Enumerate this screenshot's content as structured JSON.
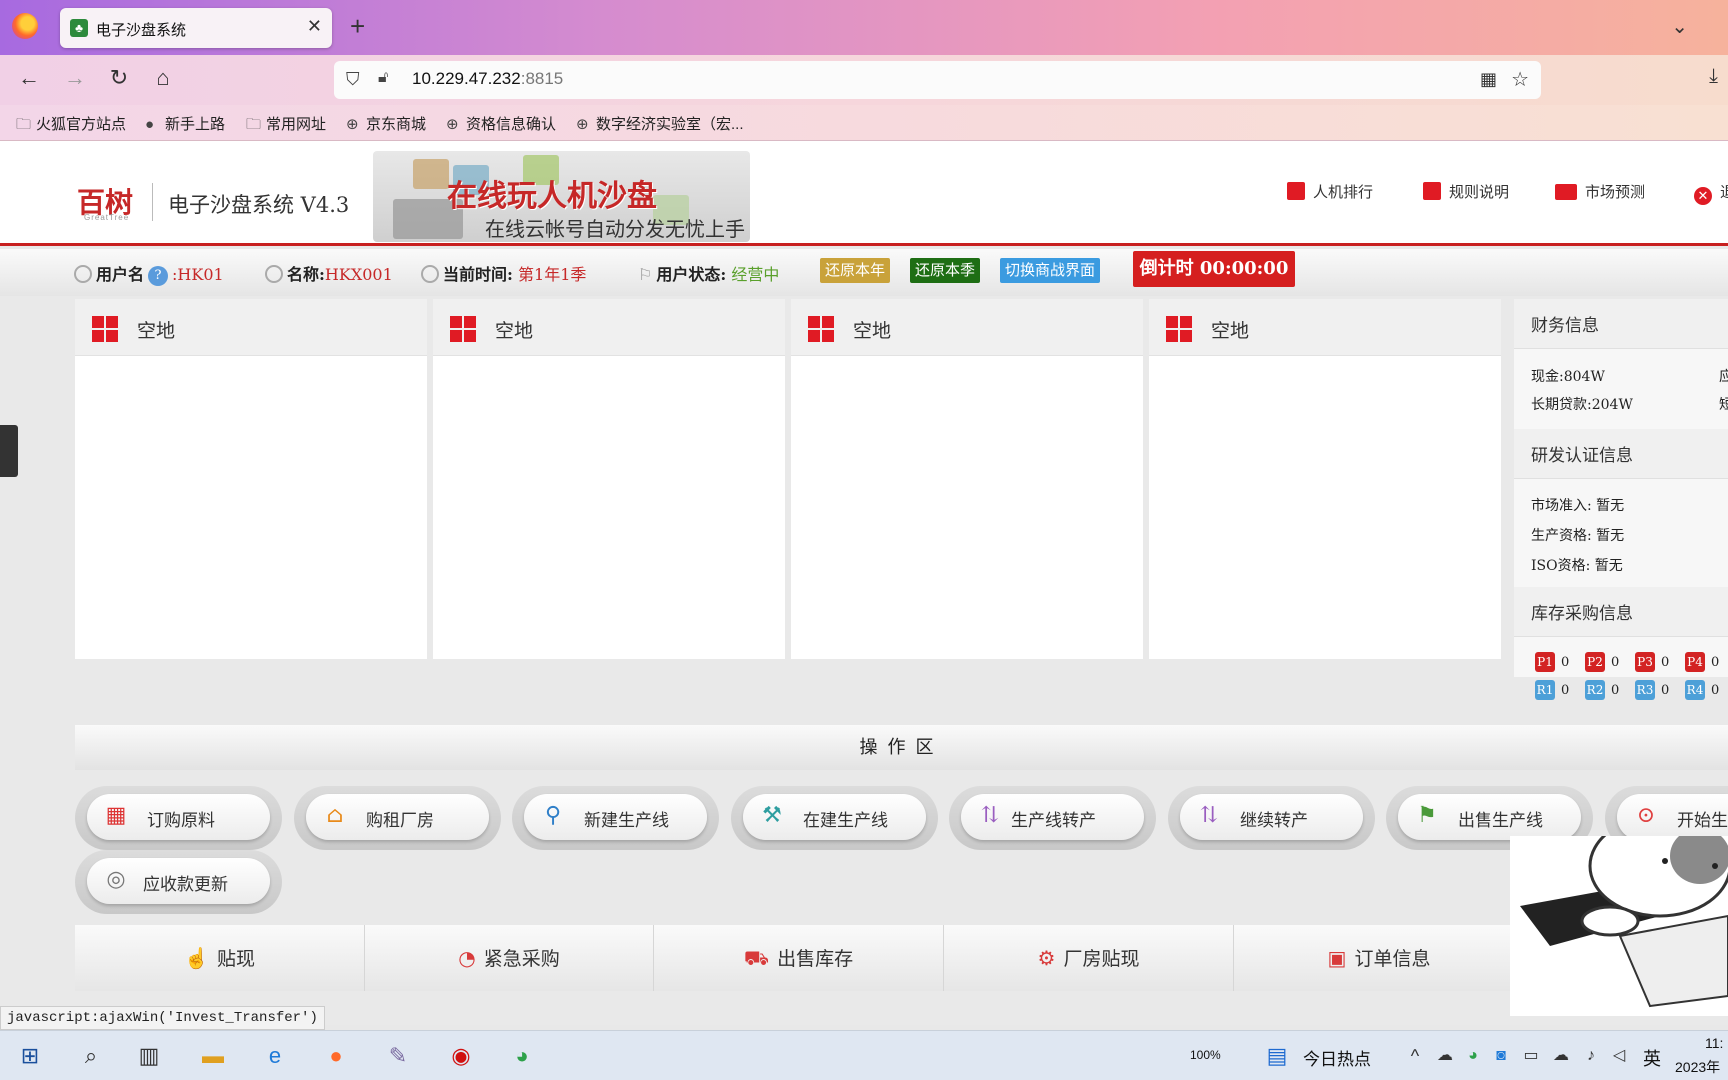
{
  "browser": {
    "tab_title": "电子沙盘系统",
    "url_host": "10.229.47.232",
    "url_port": ":8815",
    "bookmarks": [
      "火狐官方站点",
      "新手上路",
      "常用网址",
      "京东商城",
      "资格信息确认",
      "数字经济实验室（宏..."
    ]
  },
  "header": {
    "logo": "百树",
    "logo_sub": "GreatTree",
    "system_title": "电子沙盘系统 V4.3",
    "banner_main": "在线玩人机沙盘",
    "banner_sub": "在线云帐号自动分发无忧上手",
    "links": [
      "人机排行",
      "规则说明",
      "市场预测",
      "退"
    ]
  },
  "status": {
    "username_label": "用户名",
    "username_value": ":HK01",
    "name_label": "名称:",
    "name_value": "HKX001",
    "time_label": "当前时间:",
    "time_value": "第1年1季",
    "state_label": "用户状态:",
    "state_value": "经营中",
    "btn_restore_year": "还原本年",
    "btn_restore_quarter": "还原本季",
    "btn_switch": "切换商战界面",
    "countdown": "倒计时 00:00:00",
    "colors": {
      "restore_year": "#c9a23a",
      "restore_quarter": "#1e6e14",
      "switch": "#3b9be0",
      "countdown": "#d51f1f"
    }
  },
  "panels": [
    {
      "title": "空地"
    },
    {
      "title": "空地"
    },
    {
      "title": "空地"
    },
    {
      "title": "空地"
    }
  ],
  "info": {
    "finance_title": "财务信息",
    "cash": "现金:804W",
    "cash_right": "应",
    "long_loan": "长期贷款:204W",
    "long_loan_right": "短",
    "rd_title": "研发认证信息",
    "market_access": "市场准入: 暂无",
    "production_qual": "生产资格: 暂无",
    "iso_qual": "ISO资格: 暂无",
    "stock_title": "库存采购信息",
    "products": [
      {
        "code": "P1",
        "qty": "0"
      },
      {
        "code": "P2",
        "qty": "0"
      },
      {
        "code": "P3",
        "qty": "0"
      },
      {
        "code": "P4",
        "qty": "0"
      }
    ],
    "raws": [
      {
        "code": "R1",
        "qty": "0"
      },
      {
        "code": "R2",
        "qty": "0"
      },
      {
        "code": "R3",
        "qty": "0"
      },
      {
        "code": "R4",
        "qty": "0"
      }
    ]
  },
  "operations": {
    "zone_title": "操作区",
    "buttons": [
      {
        "label": "订购原料",
        "icon": "calendar-icon"
      },
      {
        "label": "购租厂房",
        "icon": "house-icon"
      },
      {
        "label": "新建生产线",
        "icon": "walker-icon"
      },
      {
        "label": "在建生产线",
        "icon": "builder-icon"
      },
      {
        "label": "生产线转产",
        "icon": "runner-icon"
      },
      {
        "label": "继续转产",
        "icon": "runner-icon"
      },
      {
        "label": "出售生产线",
        "icon": "sell-line-icon"
      },
      {
        "label": "开始生",
        "icon": "start-icon"
      },
      {
        "label": "应收款更新",
        "icon": "refresh-icon"
      }
    ]
  },
  "bottom": [
    "贴现",
    "紧急采购",
    "出售库存",
    "厂房贴现",
    "订单信息"
  ],
  "status_url": "javascript:ajaxWin('Invest_Transfer')",
  "taskbar": {
    "battery": "100%",
    "news": "今日热点",
    "ime": "英",
    "time": "11:",
    "date": "2023年"
  }
}
